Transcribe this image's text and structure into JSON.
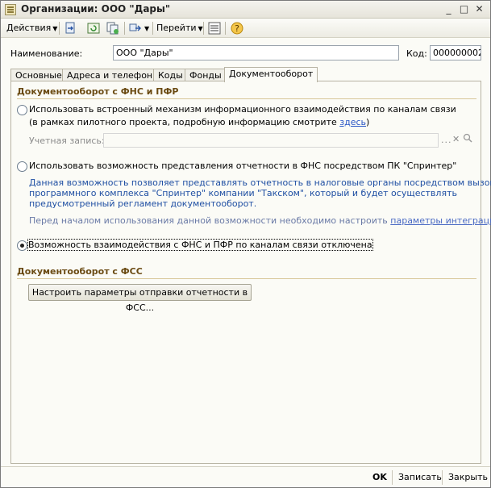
{
  "window": {
    "title": "Организации: ООО \"Дары\""
  },
  "toolbar": {
    "actions_label": "Действия",
    "goto_label": "Перейти",
    "icons": [
      "doc-arrow-icon",
      "refresh-icon",
      "copy-icon",
      "structure-icon",
      "list-icon",
      "help-icon"
    ]
  },
  "header": {
    "name_label": "Наименование:",
    "name_value": "ООО \"Дары\"",
    "code_label": "Код:",
    "code_value": "000000002"
  },
  "tabs": [
    {
      "label": "Основные"
    },
    {
      "label": "Адреса и телефоны"
    },
    {
      "label": "Коды"
    },
    {
      "label": "Фонды"
    },
    {
      "label": "Документооборот",
      "active": true
    }
  ],
  "doc_fns": {
    "section_title": "Документооборот с ФНС и ПФР",
    "option1_label": "Использовать встроенный механизм информационного взаимодействия по каналам связи",
    "option1_note_prefix": "(в рамках пилотного проекта, подробную информацию смотрите ",
    "option1_note_link": "здесь",
    "option1_note_suffix": ")",
    "account_label": "Учетная запись:",
    "account_value": "",
    "option2_label": "Использовать возможность представления отчетности в ФНС посредством ПК \"Спринтер\"",
    "option2_desc_lines": [
      "Данная возможность позволяет представлять отчетность в налоговые органы посредством вызова",
      "программного комплекса \"Спринтер\" компании \"Такском\", который и будет осуществлять",
      "предусмотренный регламент документооборот."
    ],
    "option2_hint_prefix": "Перед началом использования данной возможности необходимо настроить ",
    "option2_hint_link": "параметры интеграции.",
    "option3_label": "Возможность взаимодействия с ФНС и ПФР по каналам связи отключена",
    "selected_option": 3
  },
  "doc_fss": {
    "section_title": "Документооборот с ФСС",
    "settings_button": "Настроить параметры отправки отчетности в ФСС..."
  },
  "footer": {
    "ok_label": "OK",
    "save_label": "Записать",
    "close_label": "Закрыть"
  }
}
